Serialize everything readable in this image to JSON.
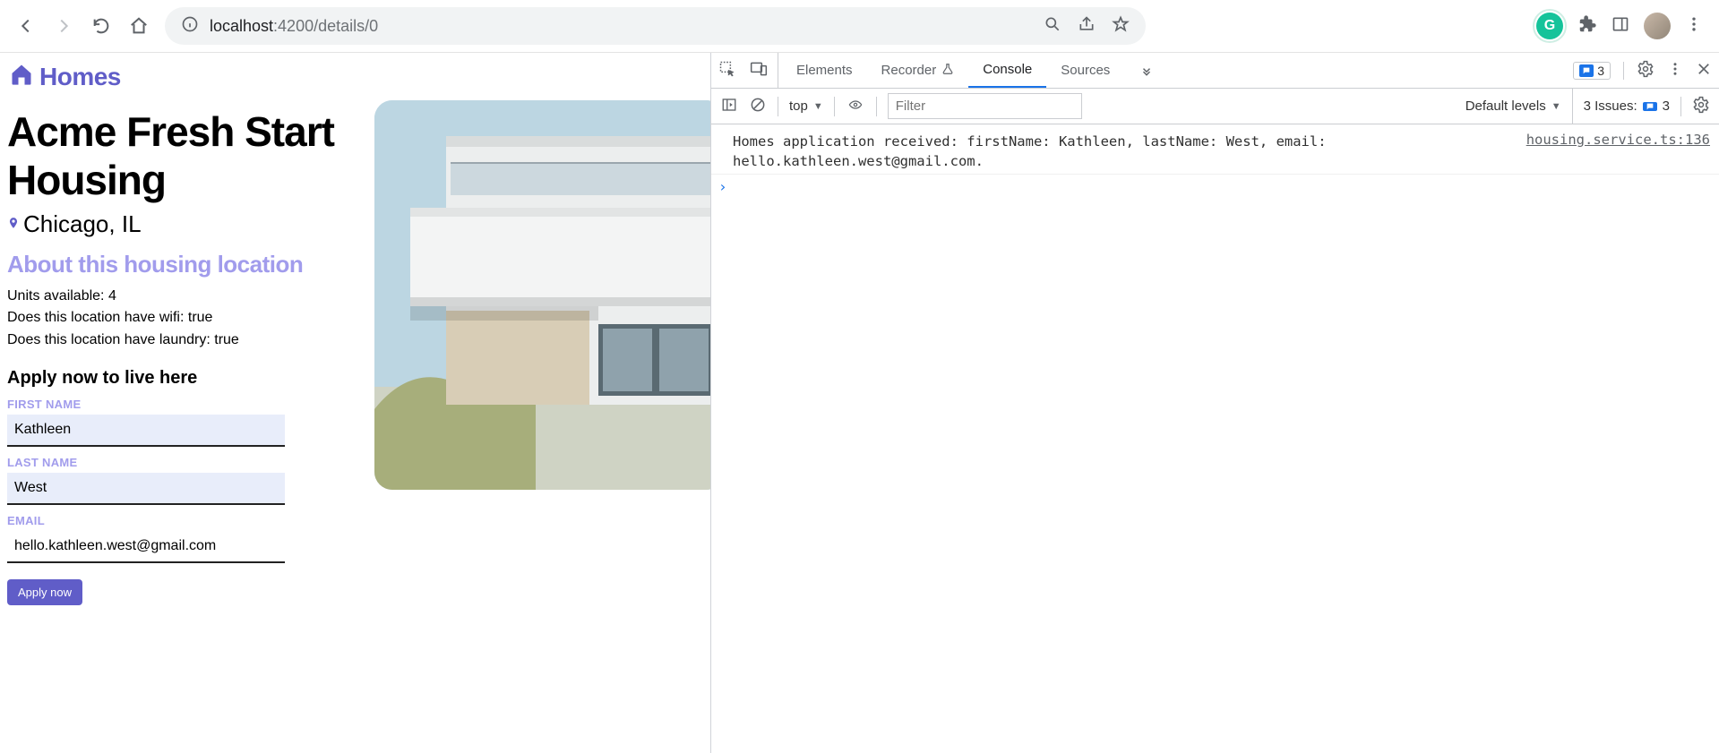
{
  "browser": {
    "url_host": "localhost",
    "url_port_path": ":4200/details/0"
  },
  "app": {
    "brand": "Homes",
    "listing": {
      "title": "Acme Fresh Start Housing",
      "location": "Chicago, IL",
      "about_heading": "About this housing location",
      "units_line": "Units available: 4",
      "wifi_line": "Does this location have wifi: true",
      "laundry_line": "Does this location have laundry: true"
    },
    "form": {
      "apply_heading": "Apply now to live here",
      "first_name_label": "FIRST NAME",
      "first_name_value": "Kathleen",
      "last_name_label": "LAST NAME",
      "last_name_value": "West",
      "email_label": "EMAIL",
      "email_value": "hello.kathleen.west@gmail.com",
      "submit_label": "Apply now"
    }
  },
  "devtools": {
    "tabs": {
      "elements": "Elements",
      "recorder": "Recorder",
      "console": "Console",
      "sources": "Sources"
    },
    "msg_badge_count": "3",
    "toolbar": {
      "context": "top",
      "filter_placeholder": "Filter",
      "levels": "Default levels",
      "issues_label": "3 Issues:",
      "issues_count": "3"
    },
    "console": {
      "message": "Homes application received: firstName: Kathleen, lastName: West, email: hello.kathleen.west@gmail.com.",
      "source": "housing.service.ts:136"
    }
  }
}
